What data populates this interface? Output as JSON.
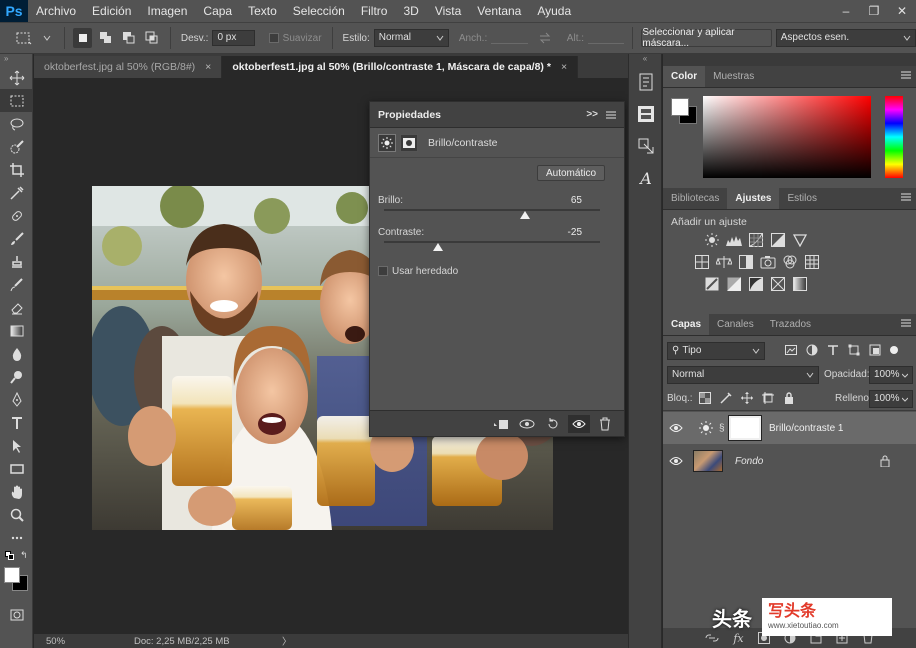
{
  "menubar": {
    "logo": "Ps",
    "items": [
      "Archivo",
      "Edición",
      "Imagen",
      "Capa",
      "Texto",
      "Selección",
      "Filtro",
      "3D",
      "Vista",
      "Ventana",
      "Ayuda"
    ],
    "window_controls": [
      "–",
      "❐",
      "✕"
    ]
  },
  "options": {
    "desv_label": "Desv.:",
    "desv_value": "0 px",
    "suavizar_label": "Suavizar",
    "estilo_label": "Estilo:",
    "estilo_value": "Normal",
    "anch_label": "Anch.:",
    "alt_label": "Alt.:",
    "mask_button": "Seleccionar y aplicar máscara...",
    "workspace": "Aspectos esen."
  },
  "tabs": [
    {
      "label": "oktoberfest.jpg al 50% (RGB/8#)",
      "close": "×",
      "active": false
    },
    {
      "label": "oktoberfest1.jpg al 50% (Brillo/contraste 1, Máscara de capa/8) *",
      "close": "×",
      "active": true
    }
  ],
  "status": {
    "zoom": "50%",
    "doc": "Doc: 2,25 MB/2,25 MB",
    "arrow": "〉"
  },
  "properties": {
    "title": "Propiedades",
    "header_icons": ">>",
    "subtitle": "Brillo/contraste",
    "auto_button": "Automático",
    "brightness_label": "Brillo:",
    "brightness_value": "65",
    "brightness_level": 0.655,
    "contrast_label": "Contraste:",
    "contrast_value": "-25",
    "contrast_level": 0.25,
    "legacy_label": "Usar heredado"
  },
  "color_panel": {
    "tabs": [
      "Color",
      "Muestras"
    ],
    "active": "Color"
  },
  "adjust_panel": {
    "tabs": [
      "Bibliotecas",
      "Ajustes",
      "Estilos"
    ],
    "active": "Ajustes",
    "heading": "Añadir un ajuste"
  },
  "layers_panel": {
    "tabs": [
      "Capas",
      "Canales",
      "Trazados"
    ],
    "active": "Capas",
    "filter_label": "Tipo",
    "blend_mode": "Normal",
    "opacity_label": "Opacidad:",
    "opacity_value": "100%",
    "lock_label": "Bloq.:",
    "fill_label": "Relleno:",
    "fill_value": "100%",
    "layers": [
      {
        "name": "Brillo/contraste 1",
        "selected": true
      },
      {
        "name": "Fondo",
        "selected": false,
        "italic": true
      }
    ]
  },
  "watermark": {
    "text1": "头条",
    "text2": "写头条",
    "url": "www.xietoutiao.com"
  },
  "colors": {
    "accent": "#31a8ff",
    "panel": "#535353",
    "dark": "#282828"
  }
}
